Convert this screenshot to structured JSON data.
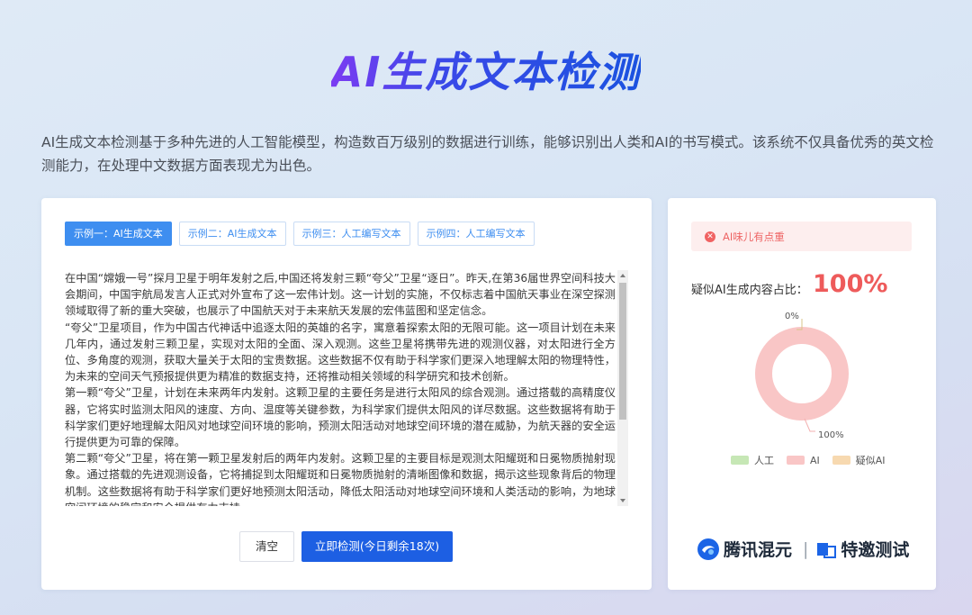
{
  "page": {
    "title": "AI生成文本检测",
    "description": "AI生成文本检测基于多种先进的人工智能模型，构造数百万级别的数据进行训练，能够识别出人类和AI的书写模式。该系统不仅具备优秀的英文检测能力，在处理中文数据方面表现尤为出色。"
  },
  "examples": {
    "tabs": [
      {
        "label": "示例一：AI生成文本",
        "active": true
      },
      {
        "label": "示例二：AI生成文本",
        "active": false
      },
      {
        "label": "示例三：人工编写文本",
        "active": false
      },
      {
        "label": "示例四：人工编写文本",
        "active": false
      }
    ]
  },
  "input": {
    "paragraphs": [
      "在中国“嫦娥一号”探月卫星于明年发射之后,中国还将发射三颗“夸父”卫星“逐日”。昨天,在第36届世界空间科技大会期间，中国宇航局发言人正式对外宣布了这一宏伟计划。这一计划的实施，不仅标志着中国航天事业在深空探测领域取得了新的重大突破，也展示了中国航天对于未来航天发展的宏伟蓝图和坚定信念。",
      "“夸父”卫星项目，作为中国古代神话中追逐太阳的英雄的名字，寓意着探索太阳的无限可能。这一项目计划在未来几年内，通过发射三颗卫星，实现对太阳的全面、深入观测。这些卫星将携带先进的观测仪器，对太阳进行全方位、多角度的观测，获取大量关于太阳的宝贵数据。这些数据不仅有助于科学家们更深入地理解太阳的物理特性，为未来的空间天气预报提供更为精准的数据支持，还将推动相关领域的科学研究和技术创新。",
      "第一颗“夸父”卫星，计划在未来两年内发射。这颗卫星的主要任务是进行太阳风的综合观测。通过搭载的高精度仪器，它将实时监测太阳风的速度、方向、温度等关键参数，为科学家们提供太阳风的详尽数据。这些数据将有助于科学家们更好地理解太阳风对地球空间环境的影响，预测太阳活动对地球空间环境的潜在威胁，为航天器的安全运行提供更为可靠的保障。",
      "第二颗“夸父”卫星，将在第一颗卫星发射后的两年内发射。这颗卫星的主要目标是观测太阳耀斑和日冕物质抛射现象。通过搭载的先进观测设备，它将捕捉到太阳耀斑和日冕物质抛射的清晰图像和数据，揭示这些现象背后的物理机制。这些数据将有助于科学家们更好地预测太阳活动，降低太阳活动对地球空间环境和人类活动的影响，为地球空间环境的稳定和安全提供有力支持。"
    ]
  },
  "actions": {
    "clear_label": "清空",
    "detect_label": "立即检测(今日剩余18次)"
  },
  "result": {
    "alert_icon": "close-circle-icon",
    "alert_text": "AI味儿有点重",
    "ratio_label": "疑似AI生成内容占比：",
    "ratio_value": "100%",
    "top_label": "0%",
    "bottom_label": "100%",
    "legend": [
      {
        "label": "人工",
        "color": "#c6e7b5"
      },
      {
        "label": "AI",
        "color": "#f9c6c6"
      },
      {
        "label": "疑似AI",
        "color": "#f7d9b0"
      }
    ]
  },
  "chart_data": {
    "type": "pie",
    "donut": true,
    "categories": [
      "人工",
      "AI",
      "疑似AI"
    ],
    "values": [
      0,
      100,
      0
    ],
    "colors": [
      "#c6e7b5",
      "#f9c6c6",
      "#f7d9b0"
    ],
    "annotations": [
      "0%",
      "100%"
    ]
  },
  "branding": {
    "brand1": "腾讯混元",
    "brand2": "特邀测试"
  }
}
